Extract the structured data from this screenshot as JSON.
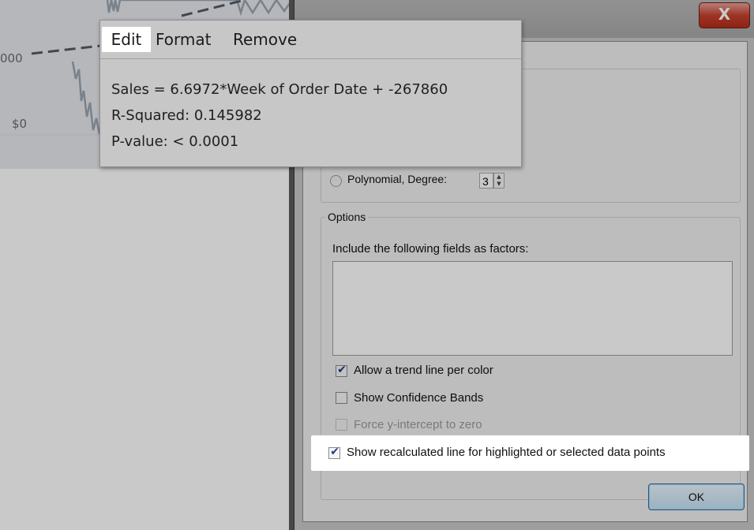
{
  "chart": {
    "y_tick_top": "000",
    "y_tick_zero": "$0"
  },
  "tooltip": {
    "menu": {
      "edit": "Edit",
      "format": "Format",
      "remove": "Remove"
    },
    "equation": "Sales = 6.6972*Week of Order Date + -267860",
    "r_squared": "R-Squared: 0.145982",
    "p_value": "P-value: < 0.0001"
  },
  "dialog": {
    "close_glyph": "X",
    "model_type": {
      "polynomial_label": "Polynomial, Degree:",
      "degree_value": "3"
    },
    "options": {
      "legend": "Options",
      "factors_label": "Include the following fields as factors:",
      "allow_trend_per_color": {
        "label": "Allow a trend line per color",
        "checked": true
      },
      "show_confidence_bands": {
        "label": "Show Confidence Bands",
        "checked": false
      },
      "force_y_intercept": {
        "label": "Force y-intercept to zero",
        "checked": false,
        "disabled": true
      },
      "show_recalculated": {
        "label": "Show recalculated line for highlighted or selected data points",
        "checked": true
      }
    },
    "ok_label": "OK"
  }
}
